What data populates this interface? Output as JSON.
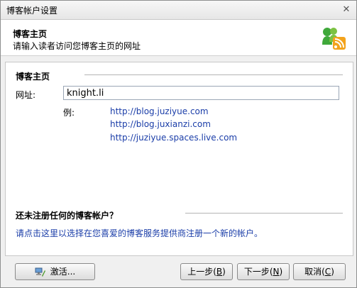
{
  "window": {
    "title": "博客帐户设置",
    "close_glyph": "✕"
  },
  "header": {
    "title": "博客主页",
    "subtitle": "请输入读者访问您博客主页的网址",
    "logo_icon": "messenger-blog-icon"
  },
  "homepage_section": {
    "title": "博客主页",
    "url_label": "网址:",
    "url_value": "knight.li",
    "example_label": "例:",
    "examples": [
      "http://blog.juziyue.com",
      "http://blog.juxianzi.com",
      "http://juziyue.spaces.live.com"
    ]
  },
  "register_section": {
    "title": "还未注册任何的博客帐户？",
    "link": "请点击这里以选择在您喜爱的博客服务提供商注册一个新的帐户。"
  },
  "buttons": {
    "activate": "激活...",
    "prev": "上一步(",
    "prev_key": "B",
    "next": "下一步(",
    "next_key": "N",
    "cancel": "取消(",
    "cancel_key": "C",
    "close_paren": ")"
  },
  "colors": {
    "link": "#1a3da8",
    "logo_green": "#3fa83a",
    "logo_orange": "#f3a31c"
  }
}
